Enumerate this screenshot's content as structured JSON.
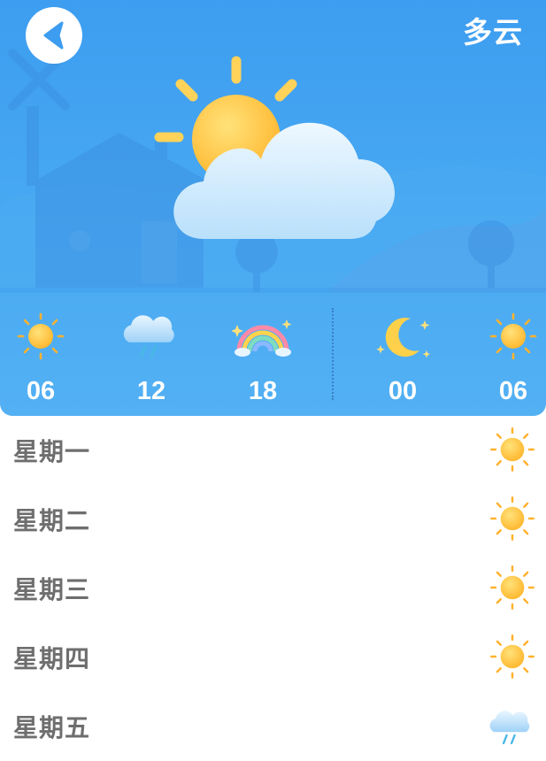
{
  "header": {
    "back_icon": "back-arrow-icon",
    "condition": "多云",
    "main_icon": "sun-behind-cloud-icon"
  },
  "hourly": [
    {
      "time": "06",
      "icon": "sun-icon"
    },
    {
      "time": "12",
      "icon": "rain-cloud-icon"
    },
    {
      "time": "18",
      "icon": "rainbow-icon"
    },
    {
      "time": "00",
      "icon": "moon-icon"
    },
    {
      "time": "06",
      "icon": "sun-icon"
    }
  ],
  "days": [
    {
      "name": "星期一",
      "icon": "sun-icon"
    },
    {
      "name": "星期二",
      "icon": "sun-icon"
    },
    {
      "name": "星期三",
      "icon": "sun-icon"
    },
    {
      "name": "星期四",
      "icon": "sun-icon"
    },
    {
      "name": "星期五",
      "icon": "rain-cloud-icon"
    }
  ],
  "colors": {
    "sky_top": "#3d9df0",
    "sky_bottom": "#5db8f6",
    "sun": "#ffc23a",
    "text_light": "#ffffff",
    "day_text": "#6e6e6e"
  }
}
